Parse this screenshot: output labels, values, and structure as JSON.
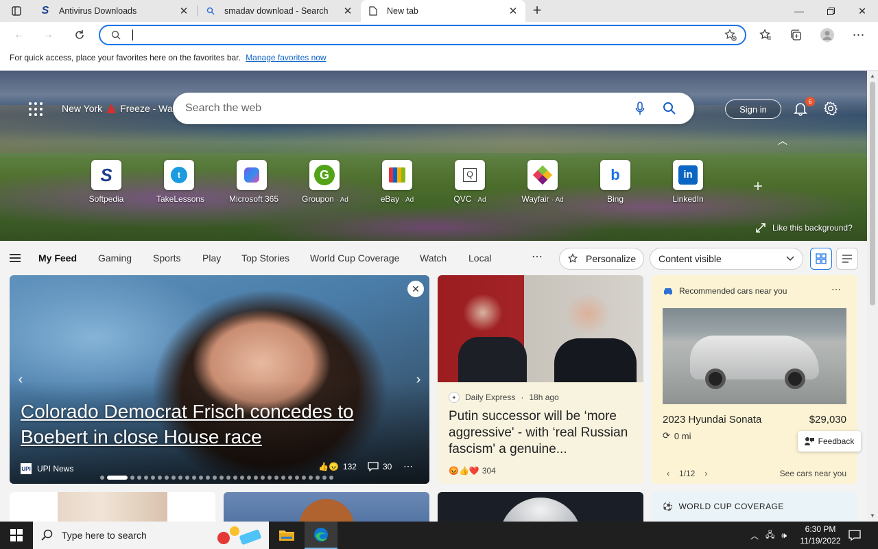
{
  "browser": {
    "tabs": [
      {
        "title": "Antivirus Downloads",
        "icon": "softpedia-s-icon"
      },
      {
        "title": "smadav download - Search",
        "icon": "search-icon"
      },
      {
        "title": "New tab",
        "icon": "page-icon",
        "active": true
      }
    ],
    "address": {
      "value": ""
    },
    "favorites_bar": {
      "text": "For quick access, place your favorites here on the favorites bar.",
      "link": "Manage favorites now"
    }
  },
  "newtab": {
    "weather": {
      "location": "New York",
      "alert": "Freeze - Wa"
    },
    "search": {
      "placeholder": "Search the web"
    },
    "sign_in": "Sign in",
    "notifications_count": "6",
    "like_background": "Like this background?",
    "tiles": [
      {
        "label": "Softpedia",
        "ad": ""
      },
      {
        "label": "TakeLessons",
        "ad": ""
      },
      {
        "label": "Microsoft 365",
        "ad": ""
      },
      {
        "label": "Groupon",
        "ad": "· Ad"
      },
      {
        "label": "eBay",
        "ad": "· Ad"
      },
      {
        "label": "QVC",
        "ad": "· Ad"
      },
      {
        "label": "Wayfair",
        "ad": "· Ad"
      },
      {
        "label": "Bing",
        "ad": ""
      },
      {
        "label": "LinkedIn",
        "ad": ""
      }
    ]
  },
  "feed_nav": {
    "items": [
      "My Feed",
      "Gaming",
      "Sports",
      "Play",
      "Top Stories",
      "World Cup Coverage",
      "Watch",
      "Local"
    ],
    "personalize": "Personalize",
    "content_visible": "Content visible"
  },
  "cards": {
    "main": {
      "headline": "Colorado Democrat Frisch concedes to Boebert in close House race",
      "source": "UPI News",
      "source_logo": "UPI",
      "reactions": "132",
      "comments": "30",
      "slides_total": 32,
      "slide_active": 2
    },
    "putin": {
      "source": "Daily Express",
      "age": "18h ago",
      "title": "Putin successor will be ‘more aggressive' - with ‘real Russian fascism' a genuine...",
      "reactions": "304"
    },
    "cars": {
      "header": "Recommended cars near you",
      "model": "2023 Hyundai Sonata",
      "price": "$29,030",
      "distance": "0 mi",
      "pager": "1/12",
      "see_more": "See cars near you"
    },
    "world_cup": {
      "label": "WORLD CUP COVERAGE"
    },
    "feedback": "Feedback"
  },
  "taskbar": {
    "search_placeholder": "Type here to search",
    "time": "6:30 PM",
    "date": "11/19/2022"
  },
  "colors": {
    "accent": "#1a73e8",
    "tab_bar": "#e7e7e7",
    "taskbar": "#1f1f1f"
  }
}
